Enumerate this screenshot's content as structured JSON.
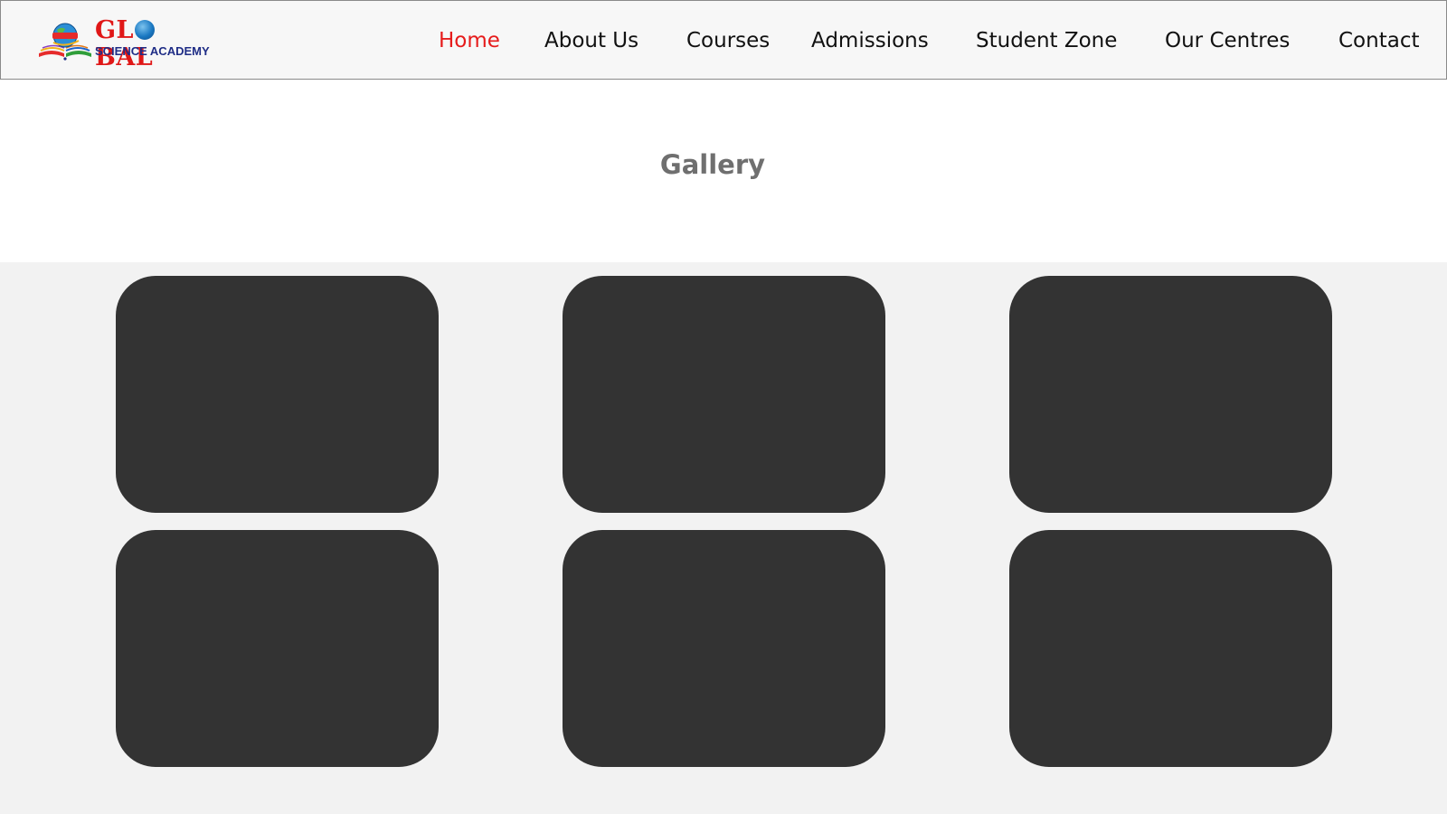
{
  "brand": {
    "logo_word_left": "GL",
    "logo_word_right": "BAL",
    "logo_subtitle": "SCIENCE ACADEMY",
    "globe_icon": "globe-book-icon",
    "colors": {
      "primary_red": "#e01717",
      "navy": "#1f2d86"
    }
  },
  "nav": {
    "active_color": "#e61b1b",
    "items": [
      {
        "label": "Home",
        "active": true
      },
      {
        "label": "About Us",
        "active": false
      },
      {
        "label": "Courses",
        "active": false
      },
      {
        "label": "Admissions",
        "active": false
      },
      {
        "label": "Student Zone",
        "active": false
      },
      {
        "label": "Our Centres",
        "active": false
      },
      {
        "label": "Contact",
        "active": false
      }
    ]
  },
  "gallery": {
    "title": "Gallery",
    "tile_color": "#333333",
    "tiles": [
      {
        "name": "gallery-image-1"
      },
      {
        "name": "gallery-image-2"
      },
      {
        "name": "gallery-image-3"
      },
      {
        "name": "gallery-image-4"
      },
      {
        "name": "gallery-image-5"
      },
      {
        "name": "gallery-image-6"
      }
    ]
  }
}
